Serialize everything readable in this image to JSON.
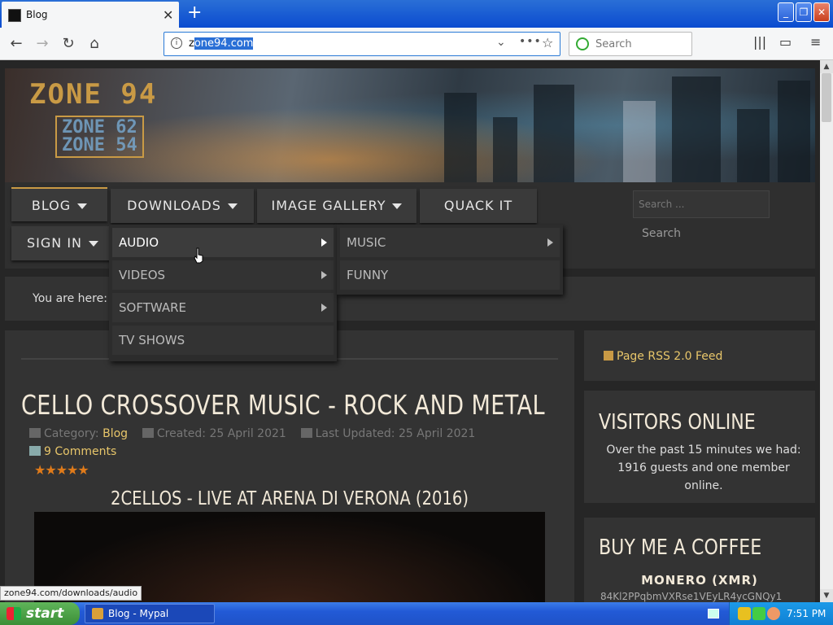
{
  "browser": {
    "tab_title": "Blog",
    "url_prefix": "z",
    "url_selected": "one94.com",
    "search_placeholder": "Search"
  },
  "site": {
    "logo_main": "ZONE 94",
    "logo_sub_1": "ZONE 62",
    "logo_sub_2": "ZONE 54"
  },
  "menu": {
    "blog": "BLOG",
    "downloads": "DOWNLOADS",
    "image_gallery": "IMAGE GALLERY",
    "quack_it": "QUACK IT",
    "sign_in": "SIGN IN"
  },
  "downloads_menu": {
    "items": [
      "AUDIO",
      "VIDEOS",
      "SOFTWARE",
      "TV SHOWS"
    ],
    "audio_submenu": [
      "MUSIC",
      "FUNNY"
    ]
  },
  "top_search": {
    "placeholder": "Search ...",
    "button": "Search"
  },
  "breadcrumb": {
    "label": "You are here:"
  },
  "article": {
    "title": "CELLO CROSSOVER MUSIC - ROCK AND METAL",
    "category_label": "Category:",
    "category": "Blog",
    "created": "Created: 25 April 2021",
    "updated": "Last Updated: 25 April 2021",
    "comments": "9 Comments",
    "stars": "★★★★★",
    "video_title": "2CELLOS - LIVE AT ARENA DI VERONA (2016)"
  },
  "sidebar": {
    "rss": "Page RSS 2.0 Feed",
    "visitors_title": "VISITORS ONLINE",
    "visitors_text": "Over the past 15 minutes we had: 1916 guests and one member online.",
    "coffee_title": "BUY ME A COFFEE",
    "monero_label": "MONERO (XMR)",
    "monero_address": "84Kl2PPqbmVXRse1VEyLR4ycGNQy1"
  },
  "status_url": "zone94.com/downloads/audio",
  "taskbar": {
    "start": "start",
    "task": "Blog - Mypal",
    "clock": "7:51 PM"
  }
}
